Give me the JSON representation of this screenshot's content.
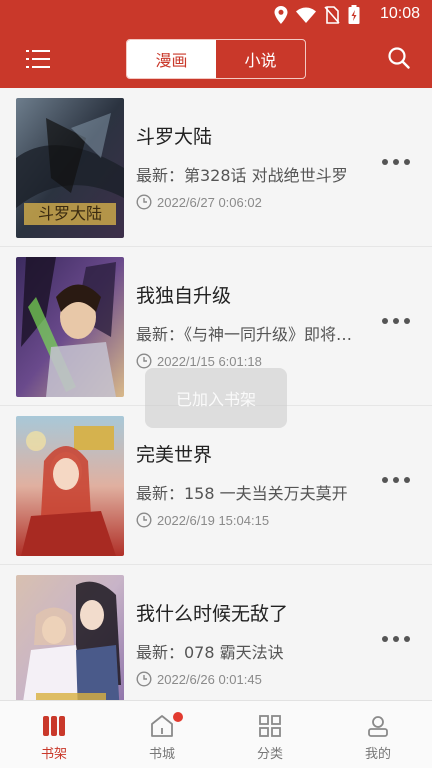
{
  "status_bar": {
    "time": "10:08"
  },
  "header": {
    "tabs": [
      {
        "label": "漫画",
        "active": true
      },
      {
        "label": "小说",
        "active": false
      }
    ],
    "accent_color": "#c9382a"
  },
  "comics": [
    {
      "title": "斗罗大陆",
      "latest": "最新：第328话 对战绝世斗罗",
      "updated": "2022/6/27 0:06:02",
      "cover_icon": "douluo-cover-image"
    },
    {
      "title": "我独自升级",
      "latest": "最新：《与神一同升级》即将上线",
      "updated": "2022/1/15 6:01:18",
      "cover_icon": "solo-leveling-cover-image"
    },
    {
      "title": "完美世界",
      "latest": "最新：158 一夫当关万夫莫开",
      "updated": "2022/6/19 15:04:15",
      "cover_icon": "perfect-world-cover-image"
    },
    {
      "title": "我什么时候无敌了",
      "latest": "最新：078 霸天法诀",
      "updated": "2022/6/26 0:01:45",
      "cover_icon": "invincible-cover-image"
    }
  ],
  "toast": {
    "text": "已加入书架"
  },
  "bottom_nav": [
    {
      "label": "书架",
      "active": true,
      "icon": "bookshelf-icon"
    },
    {
      "label": "书城",
      "active": false,
      "icon": "store-icon",
      "badge": true
    },
    {
      "label": "分类",
      "active": false,
      "icon": "category-icon"
    },
    {
      "label": "我的",
      "active": false,
      "icon": "profile-icon"
    }
  ]
}
